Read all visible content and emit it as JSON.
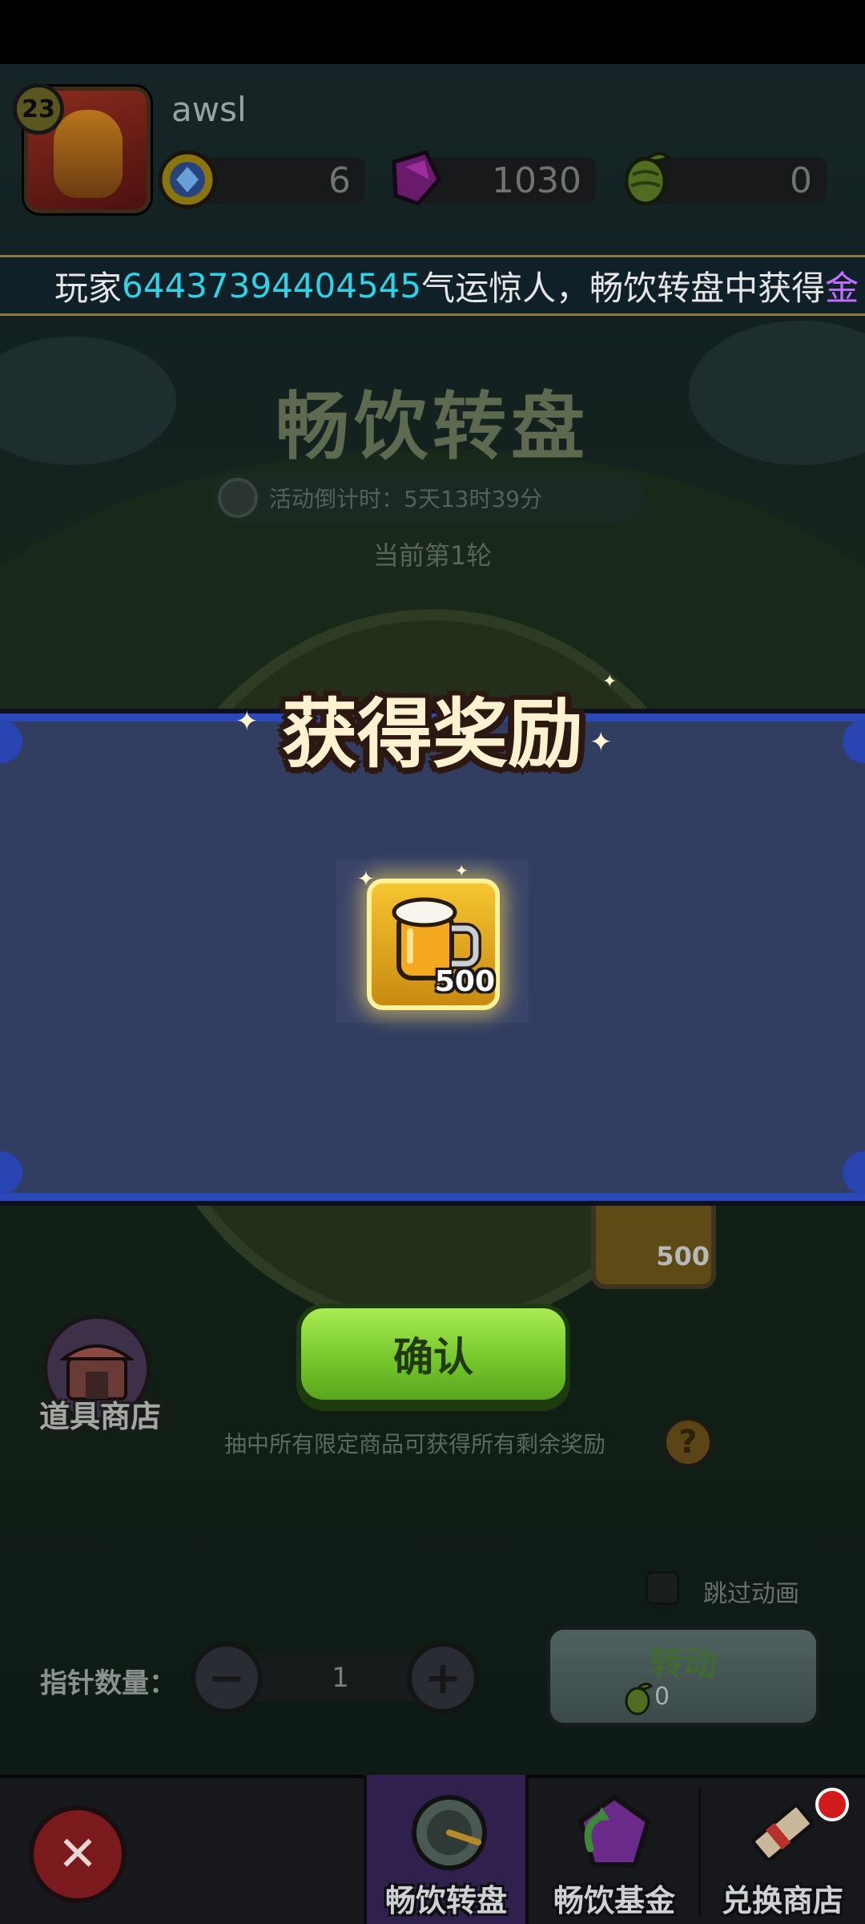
{
  "player": {
    "level": "23",
    "name": "awsl"
  },
  "resources": [
    {
      "icon": "gold-coin-icon",
      "value": "6"
    },
    {
      "icon": "purple-gem-icon",
      "value": "1030"
    },
    {
      "icon": "hop-icon",
      "value": "0"
    }
  ],
  "marquee": {
    "prefix": "玩家",
    "player_id": "64437394404545",
    "middle": "气运惊人，畅饮转盘中获得",
    "item": "金"
  },
  "event": {
    "title": "畅饮转盘",
    "countdown": "活动倒计时：5天13时39分",
    "round": "当前第1轮"
  },
  "modal": {
    "title": "获得奖励",
    "reward": {
      "icon": "beer-mug-icon",
      "count": "500"
    },
    "confirm_label": "确认"
  },
  "background_reward": {
    "count": "500"
  },
  "shop": {
    "label": "道具商店"
  },
  "hint": "抽中所有限定商品可获得所有剩余奖励",
  "help": "?",
  "skip_animation": {
    "label": "跳过动画",
    "checked": false
  },
  "pointer": {
    "label": "指针数量：",
    "value": "1",
    "minus": "−",
    "plus": "+"
  },
  "spin": {
    "label": "转动",
    "cost": "0"
  },
  "nav": {
    "close": "✕",
    "tabs": [
      {
        "label": "畅饮转盘",
        "active": true
      },
      {
        "label": "畅饮基金",
        "active": false
      },
      {
        "label": "兑换商店",
        "active": false
      }
    ]
  },
  "colors": {
    "modal_band": "#323d62",
    "modal_border": "#2c49b9",
    "confirm_green": "#76c82c",
    "cyan_highlight": "#2fd3e6"
  }
}
